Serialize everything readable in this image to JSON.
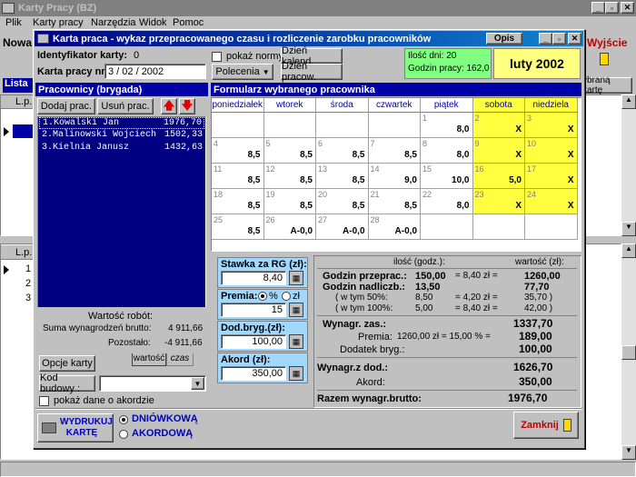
{
  "main_window": {
    "title": "Karty Pracy (BZ)"
  },
  "menu": [
    "Plik",
    "Karty pracy",
    "Narzędzia",
    "Widok",
    "Pomoc"
  ],
  "background": {
    "nowa": "Nowa",
    "wyjscie": "Wyjście",
    "lista": "Lista",
    "wybrana": "ybraną kartę",
    "lp": "L.p.",
    "rows": [
      "1",
      "2",
      "3"
    ]
  },
  "dialog": {
    "title": "Karta praca - wykaz przepracowanego czasu i rozliczenie zarobku pracowników",
    "opis": "Opis",
    "id_label": "Identyfikator karty:",
    "id_value": "0",
    "nr_label": "Karta pracy nr:",
    "nr_value": "3 / 02 / 2002",
    "pokaz_normy": "pokaż normy",
    "polecenia": "Polecenia",
    "dzien_kalend": "Dzień kalend.",
    "dzien_pracow": "Dzień pracow.",
    "ilosc_dni": "Ilość dni: 20",
    "godzin_pracy": "Godzin pracy: 162,0",
    "month": "luty 2002"
  },
  "workers": {
    "header": "Pracownicy (brygada)",
    "add": "Dodaj prac.",
    "remove": "Usuń prac.",
    "list": [
      {
        "name": "1.Kowalski Jan",
        "value": "1976,70"
      },
      {
        "name": "2.Malinowski Wojciech",
        "value": "1502,33"
      },
      {
        "name": "3.Kielnia Janusz",
        "value": "1432,63"
      }
    ],
    "wartosc_robot": "Wartość robót:",
    "suma_label": "Suma wynagrodzeń brutto:",
    "suma_value": "4 911,66",
    "pozostalo_label": "Pozostało:",
    "pozostalo_value": "-4 911,66",
    "tab1": "wartość",
    "tab2": "czas",
    "opcje": "Opcje karty",
    "kod_budowy": "Kod budowy :",
    "pokaz_akord": "pokaż dane o akordzie"
  },
  "calendar": {
    "header": "Formularz wybranego pracownika",
    "days": [
      "poniedziałek",
      "wtorek",
      "środa",
      "czwartek",
      "piątek",
      "sobota",
      "niedziela"
    ],
    "weeks": [
      [
        [
          "",
          ""
        ],
        [
          "",
          ""
        ],
        [
          "",
          ""
        ],
        [
          "",
          ""
        ],
        [
          "1",
          "8,0"
        ],
        [
          "2",
          "X"
        ],
        [
          "3",
          "X"
        ]
      ],
      [
        [
          "4",
          "8,5"
        ],
        [
          "5",
          "8,5"
        ],
        [
          "6",
          "8,5"
        ],
        [
          "7",
          "8,5"
        ],
        [
          "8",
          "8,0"
        ],
        [
          "9",
          "X"
        ],
        [
          "10",
          "X"
        ]
      ],
      [
        [
          "11",
          "8,5"
        ],
        [
          "12",
          "8,5"
        ],
        [
          "13",
          "8,5"
        ],
        [
          "14",
          "9,0"
        ],
        [
          "15",
          "10,0"
        ],
        [
          "16",
          "5,0"
        ],
        [
          "17",
          "X"
        ]
      ],
      [
        [
          "18",
          "8,5"
        ],
        [
          "19",
          "8,5"
        ],
        [
          "20",
          "8,5"
        ],
        [
          "21",
          "8,5"
        ],
        [
          "22",
          "8,0"
        ],
        [
          "23",
          "X"
        ],
        [
          "24",
          "X"
        ]
      ],
      [
        [
          "25",
          "8,5"
        ],
        [
          "26",
          "A-0,0"
        ],
        [
          "27",
          "A-0,0"
        ],
        [
          "28",
          "A-0,0"
        ],
        [
          "",
          ""
        ],
        [
          "",
          ""
        ],
        [
          "",
          ""
        ]
      ]
    ]
  },
  "rates": {
    "stawka_label": "Stawka za RG (zł):",
    "stawka_value": "8,40",
    "premia_label": "Premia:",
    "premia_opt1": "%",
    "premia_opt2": "zł",
    "premia_value": "15",
    "dod_label": "Dod.bryg.(zł):",
    "dod_value": "100,00",
    "akord_label": "Akord (zł):",
    "akord_value": "350,00"
  },
  "summary": {
    "h_ilosc": "ilość (godz.):",
    "h_wartosc": "wartość (zł):",
    "rows": [
      {
        "label": "Godzin przeprac.:",
        "qty": "150,00",
        "calc": "= 8,40 zł =",
        "val": "1260,00",
        "bold": true
      },
      {
        "label": "Godzin nadliczb.:",
        "qty": "13,50",
        "calc": "",
        "val": "77,70",
        "bold": true
      },
      {
        "label": "( w tym 50%:",
        "qty": "8,50",
        "calc": "= 4,20 zł =",
        "val": "35,70 )",
        "bold": false
      },
      {
        "label": "( w tym 100%:",
        "qty": "5,00",
        "calc": "= 8,40 zł =",
        "val": "42,00 )",
        "bold": false
      }
    ],
    "wynagr_zas_label": "Wynagr. zas.:",
    "wynagr_zas_val": "1337,70",
    "premia_label": "Premia:",
    "premia_calc": "1260,00 zł  =  15,00 % =",
    "premia_val": "189,00",
    "dodatek_label": "Dodatek bryg.:",
    "dodatek_val": "100,00",
    "wynagr_dod_label": "Wynagr.z dod.:",
    "wynagr_dod_val": "1626,70",
    "akord_label": "Akord:",
    "akord_val": "350,00",
    "razem_label": "Razem wynagr.brutto:",
    "razem_val": "1976,70"
  },
  "footer": {
    "print": "WYDRUKUJ KARTĘ",
    "opt1": "DNIÓWKOWĄ",
    "opt2": "AKORDOWĄ",
    "close": "Zamknij"
  }
}
